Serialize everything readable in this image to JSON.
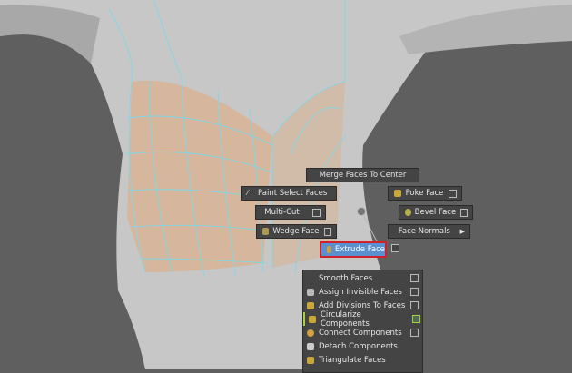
{
  "marking_menu": {
    "north": "Merge Faces To Center",
    "northwest": "Paint Select Faces",
    "northeast": "Poke Face",
    "west": "Multi-Cut",
    "east": "Bevel Face",
    "southwest": "Wedge Face",
    "southeast": "Face Normals",
    "south": "Extrude Face"
  },
  "submenu": [
    {
      "label": "Smooth Faces",
      "icon": ""
    },
    {
      "label": "Assign Invisible Faces",
      "icon": "assign-invisible-icon"
    },
    {
      "label": "Add Divisions To Faces",
      "icon": "add-divisions-icon"
    },
    {
      "label": "Circularize Components",
      "icon": "circularize-icon",
      "highlight": true
    },
    {
      "label": "Connect Components",
      "icon": "connect-icon"
    },
    {
      "label": "Detach Components",
      "icon": "detach-icon"
    },
    {
      "label": "Triangulate Faces",
      "icon": "triangulate-icon"
    }
  ],
  "colors": {
    "highlight": "#d0202a",
    "selection": "#5a8fd0",
    "wire": "#7fd8ea"
  }
}
